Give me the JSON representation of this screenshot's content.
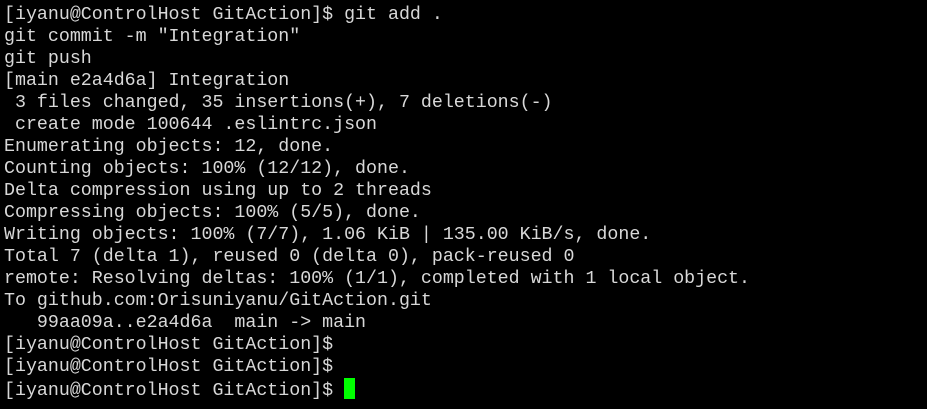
{
  "terminal": {
    "background": "#000000",
    "foreground": "#d8d8d8",
    "cursor_color": "#00ff00",
    "lines": [
      "[iyanu@ControlHost GitAction]$ git add .",
      "git commit -m \"Integration\"",
      "git push",
      "[main e2a4d6a] Integration",
      " 3 files changed, 35 insertions(+), 7 deletions(-)",
      " create mode 100644 .eslintrc.json",
      "Enumerating objects: 12, done.",
      "Counting objects: 100% (12/12), done.",
      "Delta compression using up to 2 threads",
      "Compressing objects: 100% (5/5), done.",
      "Writing objects: 100% (7/7), 1.06 KiB | 135.00 KiB/s, done.",
      "Total 7 (delta 1), reused 0 (delta 0), pack-reused 0",
      "remote: Resolving deltas: 100% (1/1), completed with 1 local object.",
      "To github.com:Orisuniyanu/GitAction.git",
      "   99aa09a..e2a4d6a  main -> main",
      "[iyanu@ControlHost GitAction]$",
      "[iyanu@ControlHost GitAction]$"
    ],
    "active_prompt": "[iyanu@ControlHost GitAction]$"
  }
}
